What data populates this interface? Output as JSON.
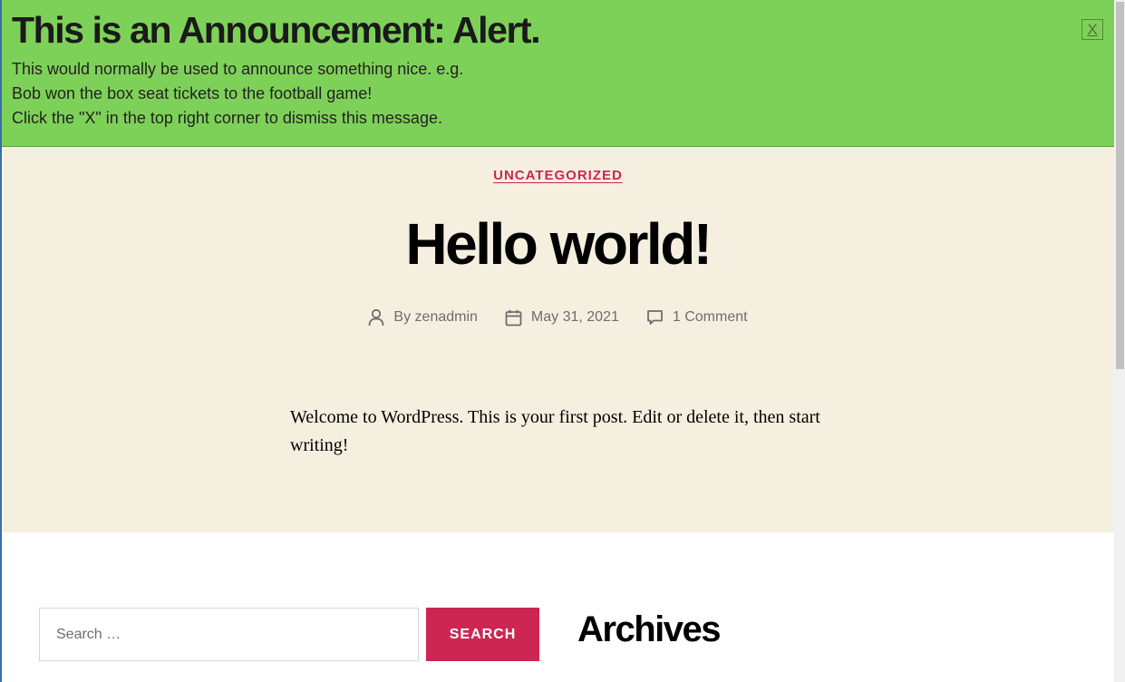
{
  "announcement": {
    "title": "This is an Announcement: Alert.",
    "lines": [
      "This would normally be used to announce something nice. e.g.",
      "Bob won the box seat tickets to the football game!",
      "Click the \"X\" in the top right corner to dismiss this message."
    ],
    "dismiss_label": "X",
    "background_color": "#7ed158"
  },
  "post": {
    "category": "UNCATEGORIZED",
    "title": "Hello world!",
    "meta": {
      "author": "By zenadmin",
      "date": "May 31, 2021",
      "comments": "1 Comment"
    },
    "content": "Welcome to WordPress. This is your first post. Edit or delete it, then start writing!",
    "background_color": "#f5efe0"
  },
  "widgets": {
    "search": {
      "placeholder": "Search …",
      "button_label": "SEARCH",
      "accent_color": "#cd2653"
    },
    "archives_title": "Archives"
  },
  "icons": {
    "author": "person-icon",
    "date": "calendar-icon",
    "comments": "comment-bubble-icon"
  }
}
